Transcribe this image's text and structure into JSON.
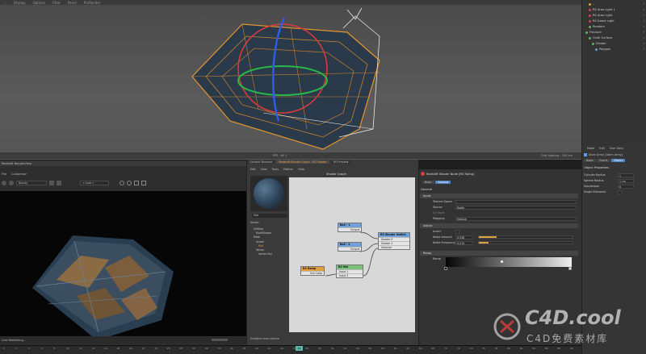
{
  "viewport": {
    "menu": [
      "...",
      "Display",
      "Options",
      "Filter",
      "Panel",
      "ProRender"
    ],
    "fps_label": "FPS : 62.1",
    "grid_spacing": "Grid Spacing : 100 cm"
  },
  "object_manager": {
    "items": [
      {
        "name": "...",
        "color": "#e0a020",
        "indent": 8
      },
      {
        "name": "RS Area Light 1",
        "color": "#e04040",
        "indent": 8
      },
      {
        "name": "RS Area Light",
        "color": "#e04040",
        "indent": 8
      },
      {
        "name": "RS Dome Light",
        "color": "#e04040",
        "indent": 8
      },
      {
        "name": "Random",
        "color": "#60b060",
        "indent": 8
      },
      {
        "name": "Fracture",
        "color": "#60b060",
        "indent": 4
      },
      {
        "name": "Cloth Surface",
        "color": "#60b060",
        "indent": 8
      },
      {
        "name": "Divider",
        "color": "#60b060",
        "indent": 12
      },
      {
        "name": "Polygon",
        "color": "#5aa0e0",
        "indent": 16
      }
    ]
  },
  "attribute_manager": {
    "menu": [
      "Mode",
      "Edit",
      "User Data"
    ],
    "title": "Atom Array [Atom Array]",
    "tabs": [
      "Basic",
      "Coord.",
      "Object"
    ],
    "section": "Object Properties",
    "props": [
      {
        "label": "Cylinder Radius",
        "value": "1"
      },
      {
        "label": "Sphere Radius",
        "value": "1 cm"
      },
      {
        "label": "Subdivision",
        "value": "8"
      },
      {
        "label": "Single Elements",
        "value": ""
      }
    ]
  },
  "render_view": {
    "title": "Redshift RenderView",
    "menu": [
      "File",
      "Customize"
    ],
    "beauty": "Beauty",
    "aov": "< Auto >",
    "status": "Live Rendering..."
  },
  "node_editor": {
    "tabs": [
      "Content Browser",
      "Redshift Shader Graph - RS Shader",
      "RS Preview"
    ],
    "menu": [
      "Edit",
      "View",
      "Tools",
      "Pattern",
      "Help"
    ],
    "title": "Shader Graph",
    "preview_name": "Mat",
    "tree_header": "Nodes",
    "tree": [
      "Utilities",
      "MultiShader",
      "Math",
      "Scalar",
      "Mul",
      "Vector",
      "Vector Mul"
    ],
    "description": "Gradient ramp texture",
    "nodes": {
      "ball1": {
        "title": "Ball - 1",
        "port": "Output"
      },
      "ball2": {
        "title": "Ball - 2",
        "port": "Output"
      },
      "switch": {
        "title": "RS Shader Switch",
        "ports": [
          "Shader 0",
          "Shader 1",
          "Selector"
        ],
        "out": "Out Color"
      },
      "ramp": {
        "title": "RS Ramp",
        "port": "Out Color"
      },
      "mul": {
        "title": "RS Mul",
        "ports": [
          "Input 1",
          "Input 2"
        ],
        "out": "Out"
      }
    }
  },
  "shader_panel": {
    "header": "Redshift Shader Node [RS Ramp]",
    "tabs": [
      "Basic",
      "General"
    ],
    "section_general": "General",
    "section_input": "Input",
    "texture_space_label": "Texture Space",
    "source_label": "Source",
    "source_value": "Radio",
    "uv_label": "UV Input",
    "mapping_label": "Mapping",
    "mapping_value": "Vertical",
    "section_adjust": "Adjust",
    "invert_label": "Invert",
    "noise_amount_label": "Noise Amount",
    "noise_amount_value": "0.336",
    "noise_freq_label": "Noise Frequency",
    "noise_freq_value": "0.214",
    "section_ramp": "Ramp",
    "ramp_label": "Ramp"
  },
  "timeline": {
    "ticks": [
      "0",
      "2",
      "4",
      "6",
      "8",
      "10",
      "12",
      "14",
      "16",
      "18",
      "20",
      "22",
      "24",
      "26",
      "28",
      "30",
      "32",
      "34",
      "36",
      "38",
      "40",
      "42",
      "44",
      "46",
      "48",
      "50",
      "52",
      "54",
      "56",
      "58",
      "60",
      "62",
      "64",
      "66",
      "68",
      "70",
      "72",
      "74",
      "76",
      "78",
      "80",
      "82",
      "84",
      "86",
      "88",
      "90"
    ],
    "current_frame": "40"
  },
  "watermark": {
    "brand": "C4D.cool",
    "subtitle": "C4D免费素材库"
  }
}
